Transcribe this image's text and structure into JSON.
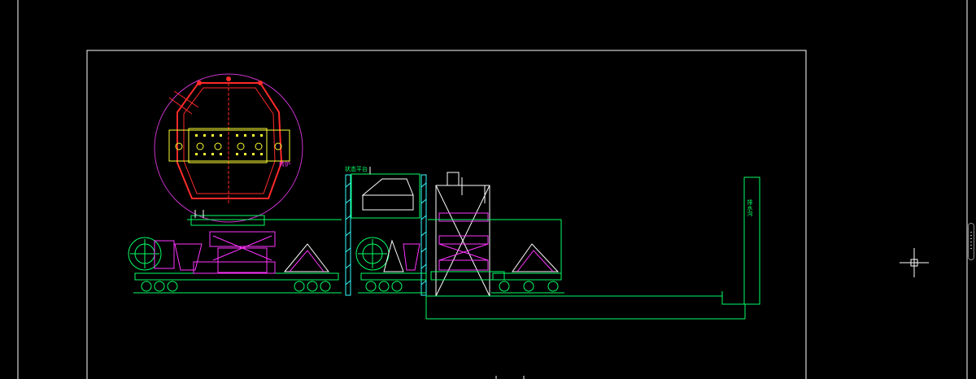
{
  "app": {
    "title": "",
    "background": "#000000"
  },
  "drawing": {
    "labels": {
      "platform": "状态平台",
      "vertical_note": "排水沟",
      "left_tag": "转炉"
    },
    "colors": {
      "outline": "#ffffff",
      "green": "#00ff66",
      "magenta": "#ff33ff",
      "red": "#ff2a2a",
      "yellow": "#ffff33",
      "cyan": "#33ffff",
      "circle": "#cc33cc"
    }
  },
  "crosshair": {
    "icon": "crosshair-cursor-icon"
  },
  "scrollbar": {
    "icon": "vertical-scrollbar-icon"
  }
}
